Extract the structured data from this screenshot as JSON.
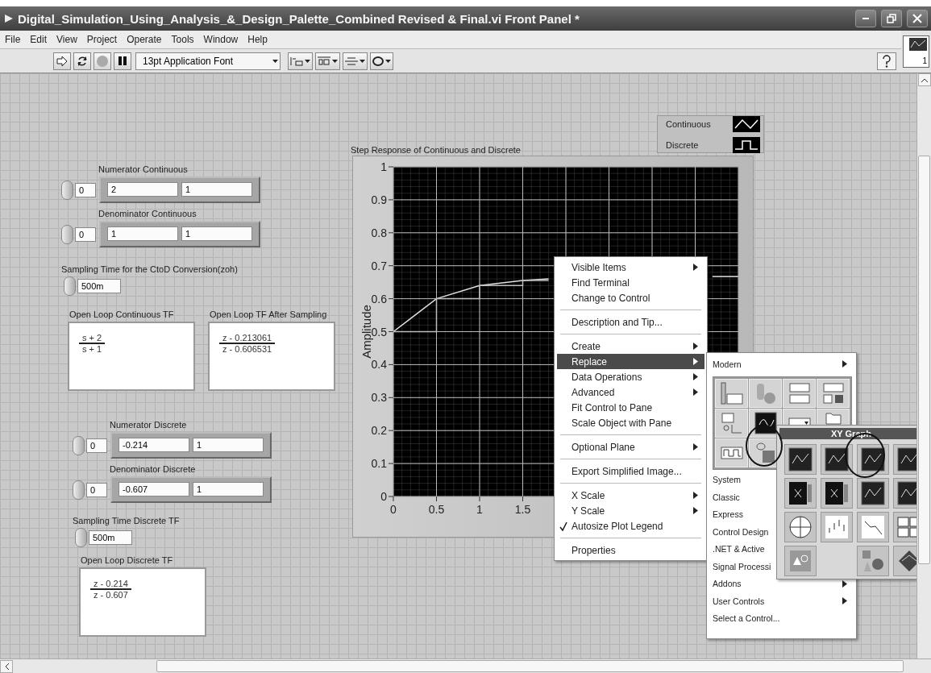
{
  "window": {
    "title": "Digital_Simulation_Using_Analysis_&_Design_Palette_Combined Revised & Final.vi Front Panel *"
  },
  "menu_bar": [
    "File",
    "Edit",
    "View",
    "Project",
    "Operate",
    "Tools",
    "Window",
    "Help"
  ],
  "toolbar": {
    "font": "13pt Application Font",
    "connector_number": "1"
  },
  "panel": {
    "controls": [
      {
        "kind": "array",
        "label": "Numerator Continuous",
        "index": "0",
        "elements": [
          "2",
          "1"
        ]
      },
      {
        "kind": "array",
        "label": "Denominator Continuous",
        "index": "0",
        "elements": [
          "1",
          "1"
        ]
      },
      {
        "kind": "numeric",
        "label": "Sampling Time for the CtoD Conversion(zoh)",
        "value": "500m"
      },
      {
        "kind": "tf",
        "label": "Open Loop Continuous TF",
        "numerator": "s + 2",
        "denominator": "s + 1"
      },
      {
        "kind": "tf",
        "label": "Open Loop TF After Sampling",
        "numerator": "z - 0.213061",
        "denominator": "z - 0.606531"
      },
      {
        "kind": "array",
        "label": "Numerator Discrete",
        "index": "0",
        "elements": [
          "-0.214",
          "1"
        ]
      },
      {
        "kind": "array",
        "label": "Denominator Discrete",
        "index": "0",
        "elements": [
          "-0.607",
          "1"
        ]
      },
      {
        "kind": "numeric",
        "label": "Sampling Time Discrete TF",
        "value": "500m"
      },
      {
        "kind": "tf",
        "label": "Open Loop Discrete TF",
        "numerator": "z - 0.214",
        "denominator": "z - 0.607"
      }
    ]
  },
  "graph": {
    "chart_data": {
      "type": "line",
      "title": "Step Response of Continuous and Discrete",
      "ylabel": "Amplitude",
      "grid": true,
      "x": [
        0,
        0.5,
        0.5,
        1,
        1,
        1.5,
        1.5,
        1.8,
        2.5,
        3.7,
        4
      ],
      "xlim": [
        0,
        4
      ],
      "ylim": [
        0,
        1
      ],
      "xticks": [
        0,
        0.5,
        1,
        1.5
      ],
      "yticks": [
        0,
        0.1,
        0.2,
        0.3,
        0.4,
        0.5,
        0.6,
        0.7,
        0.8,
        0.9,
        1
      ],
      "series": [
        {
          "name": "Continuous",
          "color": "#e0e0e0",
          "values": [
            0.5,
            0.6,
            0.6,
            0.64,
            0.64,
            0.655,
            0.655,
            0.66,
            null,
            0.667,
            0.667
          ]
        },
        {
          "name": "Discrete",
          "color": "#bdbdbd",
          "values": [
            0.5,
            0.5,
            0.6,
            0.6,
            0.64,
            0.64,
            0.655,
            0.655,
            null,
            0.667,
            0.667
          ]
        }
      ]
    }
  },
  "context_menu": {
    "items": [
      {
        "kind": "item",
        "label": "Visible Items",
        "submenu": true,
        "selected": false,
        "checked": false
      },
      {
        "kind": "item",
        "label": "Find Terminal",
        "submenu": false,
        "selected": false,
        "checked": false
      },
      {
        "kind": "item",
        "label": "Change to Control",
        "submenu": false,
        "selected": false,
        "checked": false
      },
      {
        "kind": "separator"
      },
      {
        "kind": "item",
        "label": "Description and Tip...",
        "submenu": false,
        "selected": false,
        "checked": false
      },
      {
        "kind": "separator"
      },
      {
        "kind": "item",
        "label": "Create",
        "submenu": true,
        "selected": false,
        "checked": false
      },
      {
        "kind": "item",
        "label": "Replace",
        "submenu": true,
        "selected": true,
        "checked": false
      },
      {
        "kind": "item",
        "label": "Data Operations",
        "submenu": true,
        "selected": false,
        "checked": false
      },
      {
        "kind": "item",
        "label": "Advanced",
        "submenu": true,
        "selected": false,
        "checked": false
      },
      {
        "kind": "item",
        "label": "Fit Control to Pane",
        "submenu": false,
        "selected": false,
        "checked": false
      },
      {
        "kind": "item",
        "label": "Scale Object with Pane",
        "submenu": false,
        "selected": false,
        "checked": false
      },
      {
        "kind": "separator"
      },
      {
        "kind": "item",
        "label": "Optional Plane",
        "submenu": true,
        "selected": false,
        "checked": false
      },
      {
        "kind": "separator"
      },
      {
        "kind": "item",
        "label": "Export Simplified Image...",
        "submenu": false,
        "selected": false,
        "checked": false
      },
      {
        "kind": "separator"
      },
      {
        "kind": "item",
        "label": "X Scale",
        "submenu": true,
        "selected": false,
        "checked": false
      },
      {
        "kind": "item",
        "label": "Y Scale",
        "submenu": true,
        "selected": false,
        "checked": false
      },
      {
        "kind": "item",
        "label": "Autosize Plot Legend",
        "submenu": false,
        "selected": false,
        "checked": true
      },
      {
        "kind": "separator"
      },
      {
        "kind": "item",
        "label": "Properties",
        "submenu": false,
        "selected": false,
        "checked": false
      }
    ]
  },
  "replace_menu": {
    "items": [
      {
        "kind": "item",
        "label": "Modern",
        "submenu": true
      },
      {
        "kind": "palette"
      },
      {
        "kind": "item",
        "label": "System"
      },
      {
        "kind": "item",
        "label": "Classic"
      },
      {
        "kind": "item",
        "label": "Express"
      },
      {
        "kind": "item",
        "label": "Control Design"
      },
      {
        "kind": "item",
        "label": ".NET & Active"
      },
      {
        "kind": "item",
        "label": "Signal Processi"
      },
      {
        "kind": "item",
        "label": "Addons",
        "submenu": true
      },
      {
        "kind": "item",
        "label": "User Controls",
        "submenu": true
      },
      {
        "kind": "item",
        "label": "Select a Control...",
        "submenu": false
      }
    ]
  },
  "xy_palette": {
    "title": "XY Graph"
  }
}
